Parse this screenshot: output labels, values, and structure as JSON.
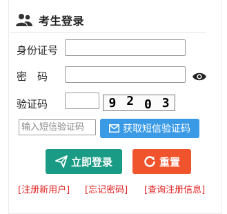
{
  "header": {
    "title": "考生登录",
    "icon": "users-icon"
  },
  "form": {
    "id_label": "身份证号",
    "password_label": "密　码",
    "captcha_label": "验证码",
    "captcha_text": [
      "9",
      "2",
      "0",
      "3"
    ],
    "sms_placeholder": "输入短信验证码",
    "sms_button": "获取短信验证码",
    "sms_icon": "envelope-icon",
    "eye_icon": "eye-icon"
  },
  "buttons": {
    "login": "立即登录",
    "login_icon": "send-icon",
    "reset": "重置",
    "reset_icon": "refresh-icon"
  },
  "links": {
    "register": "[注册新用户]",
    "forgot": "[忘记密码]",
    "query": "[查询注册信息]"
  },
  "colors": {
    "login_button": "#1a9b85",
    "reset_button": "#f0542c",
    "sms_button": "#3a9ae6",
    "links": "#e02020"
  }
}
